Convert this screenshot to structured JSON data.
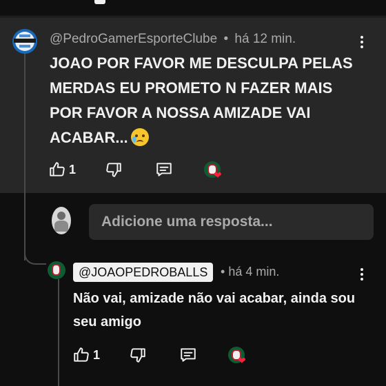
{
  "comment": {
    "author": "@PedroGamerEsporteClube",
    "separator": "•",
    "time": "há 12 min.",
    "text": "JOAO POR FAVOR ME DESCULPA PELAS MERDAS EU PROMETO N FAZER MAIS POR FAVOR A NOSSA AMIZADE VAI ACABAR...",
    "emoji": "crying-face-emoji",
    "likes": "1",
    "avatar_icon": "gremio-crest-avatar"
  },
  "reply_input": {
    "placeholder": "Adicione uma resposta..."
  },
  "reply": {
    "mention": "@JOAOPEDROBALLS",
    "separator": "•",
    "time": "há 4 min.",
    "text": "Não vai, amizade não vai acabar, ainda sou seu amigo",
    "likes": "1",
    "avatar_icon": "fluminense-crest-avatar"
  },
  "icons": {
    "like": "thumbs-up-icon",
    "dislike": "thumbs-down-icon",
    "reply": "reply-comment-icon",
    "menu": "more-vert-icon",
    "creator_heart": "creator-heart-icon"
  },
  "colors": {
    "background": "#0f0f0f",
    "highlight": "#272727",
    "text": "#f1f1f1",
    "muted": "#aaaaaa",
    "heart": "#ff1f3d"
  }
}
